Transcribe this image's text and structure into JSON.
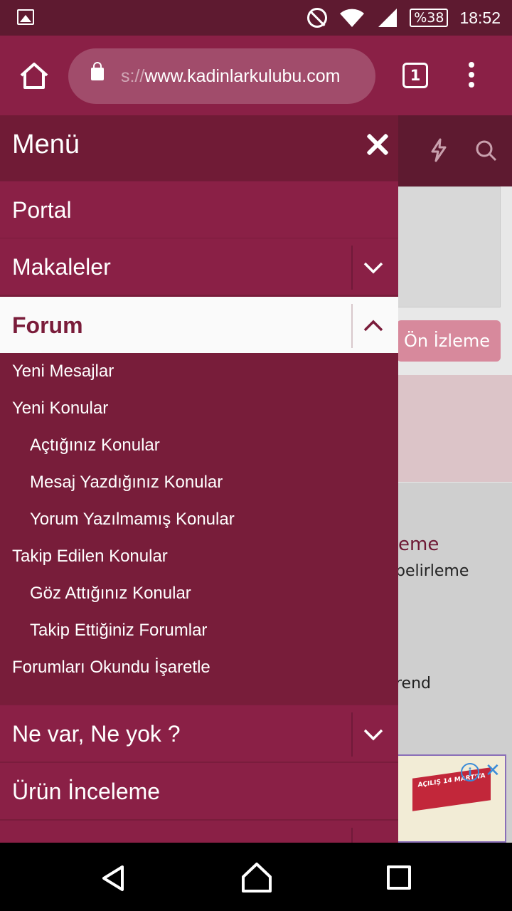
{
  "status_bar": {
    "battery": "%38",
    "time": "18:52"
  },
  "browser": {
    "url_prefix": "s://",
    "url": "www.kadinlarkulubu.com",
    "tab_count": "1"
  },
  "page_behind": {
    "preview_button": "Ön İzleme",
    "text1": "eme",
    "text2": "belirleme",
    "text3": "rend",
    "ad_info": "i",
    "ad_close": "✕",
    "ad_banner": "AÇILIŞ 14 MART'TA"
  },
  "drawer": {
    "title": "Menü",
    "items": [
      {
        "label": "Portal"
      },
      {
        "label": "Makaleler"
      },
      {
        "label": "Forum"
      },
      {
        "label": "Ne var, Ne yok ?"
      },
      {
        "label": "Ürün İnceleme"
      }
    ],
    "forum_sub": [
      {
        "label": "Yeni Mesajlar"
      },
      {
        "label": "Yeni Konular"
      },
      {
        "label": "Açtığınız Konular"
      },
      {
        "label": "Mesaj Yazdığınız Konular"
      },
      {
        "label": "Yorum Yazılmamış Konular"
      },
      {
        "label": "Takip Edilen Konular"
      },
      {
        "label": "Göz Attığınız Konular"
      },
      {
        "label": "Takip Ettiğiniz Forumlar"
      },
      {
        "label": "Forumları Okundu İşaretle"
      }
    ]
  }
}
